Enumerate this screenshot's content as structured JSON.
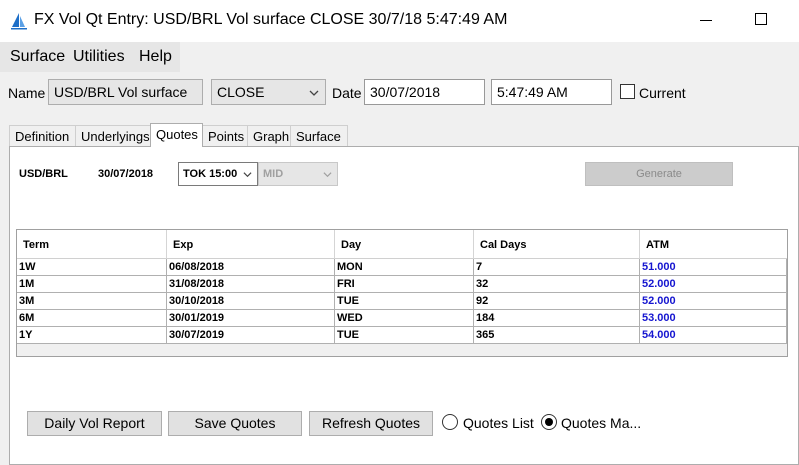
{
  "window": {
    "title": "FX Vol Qt Entry: USD/BRL Vol surface CLOSE 30/7/18 5:47:49 AM"
  },
  "menu": {
    "items": [
      "Surface",
      "Utilities",
      "Help"
    ]
  },
  "header": {
    "name_label": "Name",
    "name_value": "USD/BRL Vol surface",
    "type_value": "CLOSE",
    "date_label": "Date",
    "date_value": "30/07/2018",
    "time_value": "5:47:49 AM",
    "current_label": "Current"
  },
  "tabs": [
    "Definition",
    "Underlyings",
    "Quotes",
    "Points",
    "Graph",
    "Surface"
  ],
  "quotes": {
    "pair": "USD/BRL",
    "date": "30/07/2018",
    "snap": "TOK 15:00",
    "side": "MID",
    "generate_label": "Generate"
  },
  "table": {
    "columns": [
      "Term",
      "Exp",
      "Day",
      "Cal Days",
      "ATM"
    ],
    "rows": [
      [
        "1W",
        "06/08/2018",
        "MON",
        "7",
        "51.000"
      ],
      [
        "1M",
        "31/08/2018",
        "FRI",
        "32",
        "52.000"
      ],
      [
        "3M",
        "30/10/2018",
        "TUE",
        "92",
        "52.000"
      ],
      [
        "6M",
        "30/01/2019",
        "WED",
        "184",
        "53.000"
      ],
      [
        "1Y",
        "30/07/2019",
        "TUE",
        "365",
        "54.000"
      ]
    ]
  },
  "actions": {
    "daily_vol_report": "Daily Vol Report",
    "save_quotes": "Save Quotes",
    "refresh_quotes": "Refresh Quotes",
    "quotes_list": "Quotes List",
    "quotes_matrix": "Quotes Ma..."
  },
  "colors": {
    "atm_text": "#1515d0",
    "app_icon": "#1e6fc8"
  }
}
